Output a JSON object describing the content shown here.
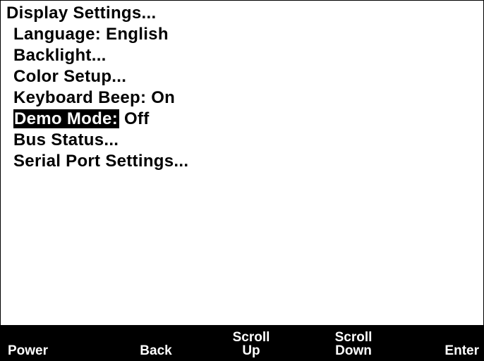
{
  "menu": {
    "title": "Display Settings...",
    "items": [
      {
        "label": "Language:",
        "value": " English"
      },
      {
        "label": "Backlight..."
      },
      {
        "label": "Color Setup..."
      },
      {
        "label": "Keyboard Beep:",
        "value": " On"
      },
      {
        "label": "Demo Mode:",
        "value": " Off",
        "selected": true
      },
      {
        "label": "Bus Status..."
      },
      {
        "label": "Serial Port Settings..."
      }
    ]
  },
  "softkeys": {
    "power": {
      "line1": "Power"
    },
    "back": {
      "line1": "Back"
    },
    "scroll_up": {
      "line1": "Scroll",
      "line2": "Up"
    },
    "scroll_down": {
      "line1": "Scroll",
      "line2": "Down"
    },
    "enter": {
      "line1": "Enter"
    }
  },
  "colors": {
    "background": "#ffffff",
    "foreground": "#000000",
    "highlight_background": "#000000",
    "highlight_text": "#ffffff"
  }
}
